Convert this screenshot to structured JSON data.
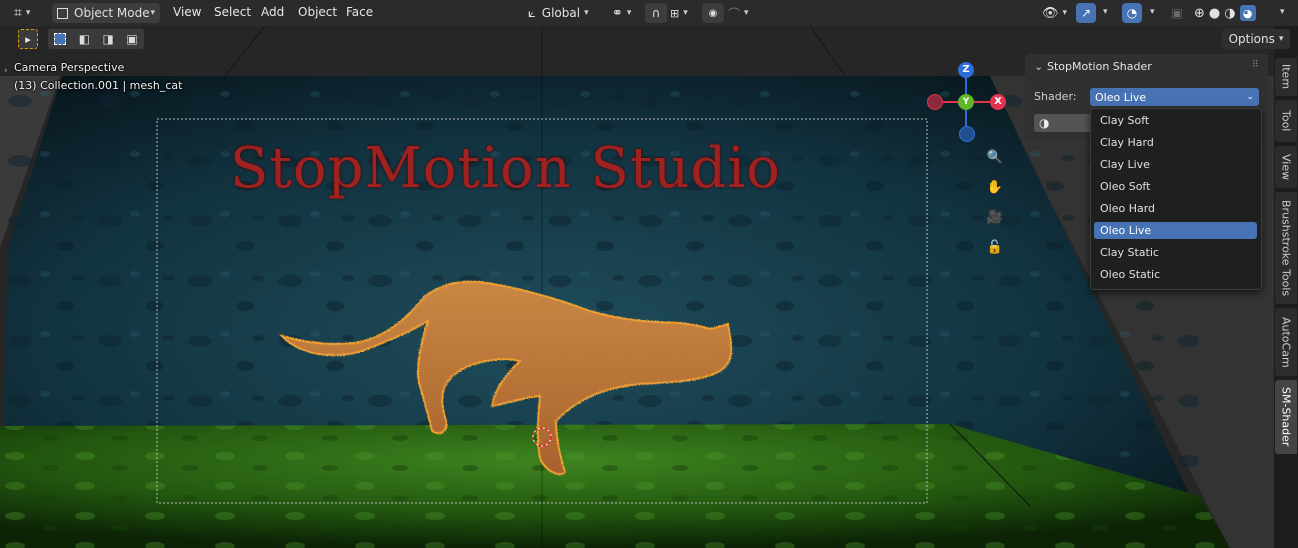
{
  "header": {
    "mode_label": "Object Mode",
    "menus": [
      "View",
      "Select",
      "Add",
      "Object",
      "Face"
    ],
    "orientation_label": "Global",
    "options_label": "Options"
  },
  "viewport": {
    "view_label": "Camera Perspective",
    "collection_label": "(13) Collection.001 | mesh_cat",
    "scene_title": "StopMotion Studio",
    "gizmo": {
      "z": "Z",
      "y": "Y",
      "x": "X"
    }
  },
  "panel": {
    "title": "StopMotion Shader",
    "shader_label": "Shader:",
    "shader_value": "Oleo Live",
    "options": [
      "Clay Soft",
      "Clay Hard",
      "Clay Live",
      "Oleo Soft",
      "Oleo Hard",
      "Oleo Live",
      "Clay Static",
      "Oleo Static"
    ],
    "selected_index": 5
  },
  "tabs": [
    "Item",
    "Tool",
    "View",
    "Brushstroke Tools",
    "AutoCam",
    "SM-Shader"
  ],
  "active_tab": "SM-Shader",
  "colors": {
    "accent": "#4772b3",
    "title_red": "#a8211f",
    "cat": "#c0773a",
    "outline": "#f0a030"
  }
}
